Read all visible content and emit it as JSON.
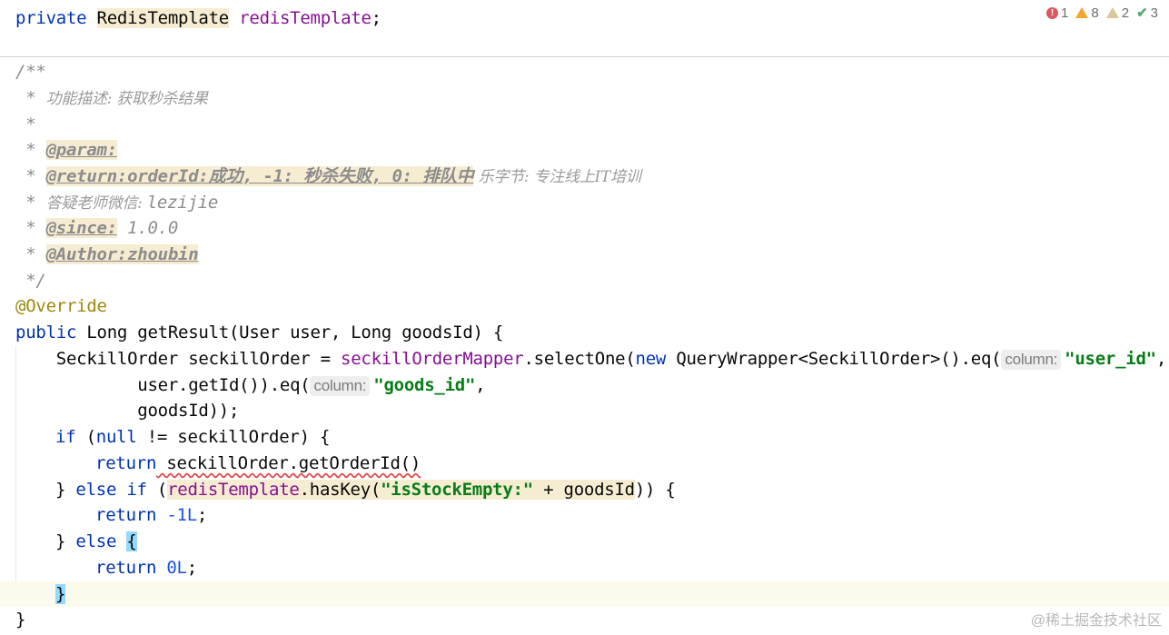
{
  "inspections": {
    "errors": "1",
    "warnings": "8",
    "weak_warnings": "2",
    "ok": "3"
  },
  "code": {
    "l1_kw": "private",
    "l1_type": "RedisTemplate",
    "l1_field": "redisTemplate",
    "l1_end": ";",
    "c1": "/**",
    "c2_star": " * ",
    "c2_text": "功能描述: 获取秒杀结果",
    "c3": " *",
    "c4_star": " * ",
    "c4_tag": "@param:",
    "c5_star": " * ",
    "c5_tag": "@return:orderId:成功, -1: 秒杀失败, 0: 排队中",
    "c5_note": " 乐字节: 专注线上IT培训",
    "c6_star": " * ",
    "c6_text": "答疑老师微信: ",
    "c6_id": "lezijie",
    "c7_star": " * ",
    "c7_tag": "@since:",
    "c7_text": " 1.0.0",
    "c8_star": " * ",
    "c8_tag": "@Author:zhoubin",
    "c9": " */",
    "annotation": "@Override",
    "sig_kw": "public",
    "sig_rest": " Long getResult(User user, Long goodsId) {",
    "s1_a": "    SeckillOrder seckillOrder = ",
    "s1_field": "seckillOrderMapper",
    "s1_b": ".selectOne(",
    "s1_new": "new",
    "s1_c": " QueryWrapper<SeckillOrder>().eq(",
    "hint_column": "column:",
    "s1_str": "\"user_id\"",
    "s1_end": ",",
    "s2_a": "            user.getId()).eq(",
    "s2_str": "\"goods_id\"",
    "s2_end": ",",
    "s3": "            goodsId));",
    "if_kw1": "if",
    "if_a": " (",
    "if_null": "null",
    "if_b": " != seckillOrder) {",
    "ret_kw": "return",
    "ret1_rest": " seckillOrder.getOrderId()",
    "elif_a": "} ",
    "elif_kw": "else if",
    "elif_b": " (",
    "elif_field": "redisTemplate",
    "elif_c": ".hasKey(",
    "elif_str": "\"isStockEmpty:\"",
    "elif_d": " + goodsId",
    "elif_e": ")) {",
    "ret2_num": "-1L",
    "ret2_end": ";",
    "else_a": "} ",
    "else_kw": "else",
    "else_brace": "{",
    "ret3_num": "0L",
    "ret3_end": ";",
    "close_inner": "}",
    "close_outer": "}"
  },
  "watermark": "@稀土掘金技术社区"
}
